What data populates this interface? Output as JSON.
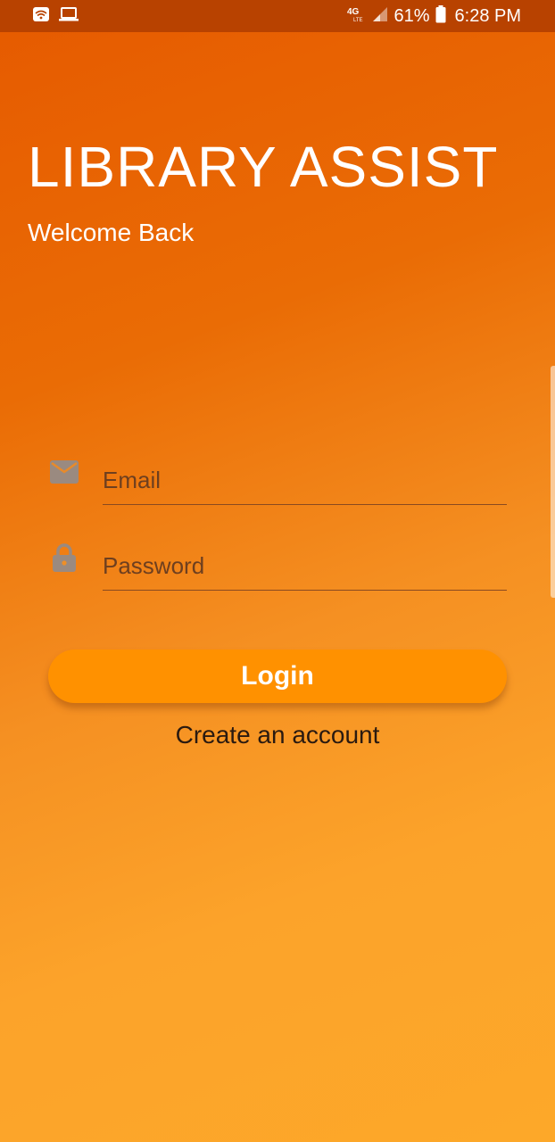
{
  "status_bar": {
    "left_icons": [
      "wifi-notification-icon",
      "laptop-icon"
    ],
    "network_label": "4G",
    "battery_percent": "61%",
    "time": "6:28 PM"
  },
  "header": {
    "title": "LIBRARY ASSIST",
    "subtitle": "Welcome Back"
  },
  "form": {
    "email": {
      "placeholder": "Email",
      "value": "",
      "icon": "mail-icon"
    },
    "password": {
      "placeholder": "Password",
      "value": "",
      "icon": "lock-icon"
    },
    "login_label": "Login",
    "create_account_label": "Create an account"
  },
  "colors": {
    "gradient_top": "#e65a00",
    "gradient_bottom": "#fda829",
    "button": "#ff9100",
    "status_bar": "#b84200"
  }
}
